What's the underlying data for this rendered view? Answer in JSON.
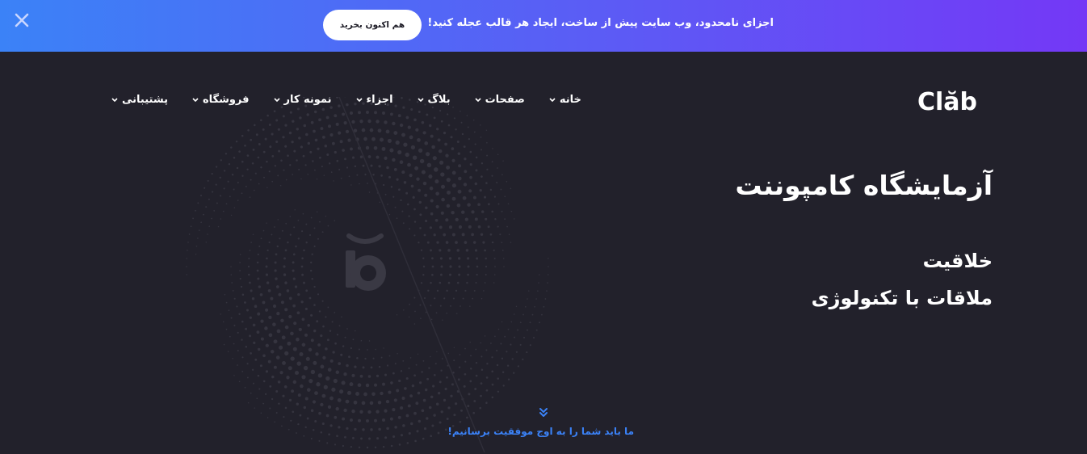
{
  "promo": {
    "close_icon": "close-icon",
    "cta_label": "هم اکنون بخرید",
    "message": "اجزای نامحدود، وب سایت پیش از ساخت، ایجاد هر قالب عجله کنید!",
    "gradient_start": "#3b82f7",
    "gradient_end": "#7438f6"
  },
  "header": {
    "logo_text": "Clăb",
    "nav": [
      {
        "label": "خانه",
        "icon": "chevron-down-icon"
      },
      {
        "label": "صفحات",
        "icon": "chevron-down-icon"
      },
      {
        "label": "بلاگ",
        "icon": "chevron-down-icon"
      },
      {
        "label": "اجزاء",
        "icon": "chevron-down-icon"
      },
      {
        "label": "نمونه کار",
        "icon": "chevron-down-icon"
      },
      {
        "label": "فروشگاه",
        "icon": "chevron-down-icon"
      },
      {
        "label": "پشتیبانی",
        "icon": "chevron-down-icon"
      }
    ]
  },
  "hero": {
    "title": "آزمایشگاه کامپوننت",
    "subtitle_line1": "خلاقیت",
    "subtitle_line2": "ملاقات با تکنولوژی",
    "decor_icon": "logo-mark-icon"
  },
  "scroll": {
    "icon": "double-chevron-down-icon",
    "text": "ما باید شما را به اوج موفقیت برسانیم!",
    "accent_color": "#3b82f7"
  },
  "colors": {
    "background": "#22212b",
    "text": "#ffffff"
  }
}
